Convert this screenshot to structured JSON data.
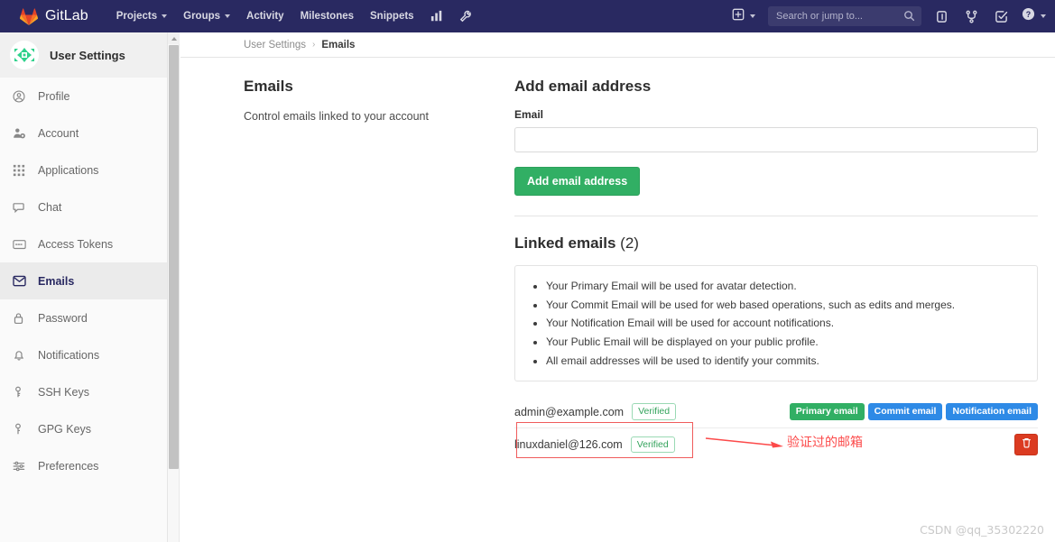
{
  "navbar": {
    "brand": "GitLab",
    "brand_icon": "gitlab-tanuki-logo",
    "links": [
      {
        "label": "Projects",
        "caret": true
      },
      {
        "label": "Groups",
        "caret": true
      },
      {
        "label": "Activity",
        "caret": false
      },
      {
        "label": "Milestones",
        "caret": false
      },
      {
        "label": "Snippets",
        "caret": false
      }
    ],
    "icon_links": [
      {
        "name": "analytics-chart-icon"
      },
      {
        "name": "wrench-admin-icon"
      }
    ],
    "plus_icon": "plus-square-icon",
    "search": {
      "placeholder": "Search or jump to...",
      "value": "",
      "icon": "search-icon"
    },
    "right_icons": [
      {
        "name": "issues-icon"
      },
      {
        "name": "merge-requests-icon"
      },
      {
        "name": "todos-icon"
      }
    ],
    "help_icon": "help-circle-icon",
    "background": "#292961"
  },
  "sidebar": {
    "title": "User Settings",
    "avatar": "user-identicon-avatar",
    "items": [
      {
        "label": "Profile",
        "icon": "user-circle-icon",
        "active": false
      },
      {
        "label": "Account",
        "icon": "account-gear-icon",
        "active": false
      },
      {
        "label": "Applications",
        "icon": "applications-grid-icon",
        "active": false
      },
      {
        "label": "Chat",
        "icon": "chat-bubble-icon",
        "active": false
      },
      {
        "label": "Access Tokens",
        "icon": "token-card-icon",
        "active": false
      },
      {
        "label": "Emails",
        "icon": "envelope-icon",
        "active": true
      },
      {
        "label": "Password",
        "icon": "lock-icon",
        "active": false
      },
      {
        "label": "Notifications",
        "icon": "bell-icon",
        "active": false
      },
      {
        "label": "SSH Keys",
        "icon": "key-icon",
        "active": false
      },
      {
        "label": "GPG Keys",
        "icon": "key-icon",
        "active": false
      },
      {
        "label": "Preferences",
        "icon": "sliders-icon",
        "active": false
      }
    ],
    "scrollbar": {
      "up_arrow_icon": "scroll-up-arrow-icon"
    }
  },
  "breadcrumb": {
    "parent": "User Settings",
    "separator": "›",
    "current": "Emails"
  },
  "emails_section": {
    "title": "Emails",
    "subtitle": "Control emails linked to your account"
  },
  "add_email": {
    "title": "Add email address",
    "field_label": "Email",
    "value": "",
    "placeholder": "",
    "button_label": "Add email address",
    "button_color": "#31af64"
  },
  "linked_emails": {
    "title": "Linked emails",
    "count": "(2)",
    "notes": [
      "Your Primary Email will be used for avatar detection.",
      "Your Commit Email will be used for web based operations, such as edits and merges.",
      "Your Notification Email will be used for account notifications.",
      "Your Public Email will be displayed on your public profile.",
      "All email addresses will be used to identify your commits."
    ],
    "rows": [
      {
        "address": "admin@example.com",
        "verified_label": "Verified",
        "badges": [
          {
            "label": "Primary email",
            "color": "#31af64"
          },
          {
            "label": "Commit email",
            "color": "#2e8ae6"
          },
          {
            "label": "Notification email",
            "color": "#2e8ae6"
          }
        ],
        "deletable": false
      },
      {
        "address": "linuxdaniel@126.com",
        "verified_label": "Verified",
        "badges": [],
        "deletable": true,
        "delete_icon": "trash-icon",
        "delete_color": "#db3b21"
      }
    ]
  },
  "annotations": {
    "arrow": "red-arrow-pointing-right",
    "highlight_box": "red-rectangle-around-second-email",
    "text": "验证过的邮箱",
    "color": "#fc4a4a"
  },
  "watermark": {
    "text": "CSDN @qq_35302220"
  }
}
